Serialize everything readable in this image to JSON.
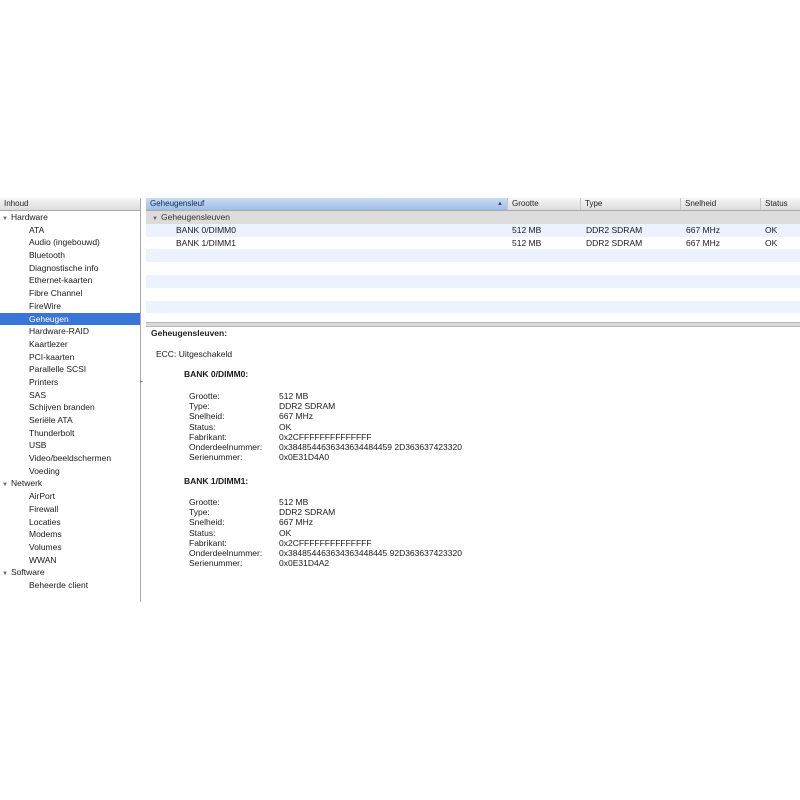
{
  "sidebar": {
    "header": "Inhoud",
    "items": [
      {
        "label": "Hardware",
        "type": "group"
      },
      {
        "label": "ATA",
        "type": "leaf"
      },
      {
        "label": "Audio (ingebouwd)",
        "type": "leaf"
      },
      {
        "label": "Bluetooth",
        "type": "leaf"
      },
      {
        "label": "Diagnostische info",
        "type": "leaf"
      },
      {
        "label": "Ethernet-kaarten",
        "type": "leaf"
      },
      {
        "label": "Fibre Channel",
        "type": "leaf"
      },
      {
        "label": "FireWire",
        "type": "leaf"
      },
      {
        "label": "Geheugen",
        "type": "leaf",
        "selected": true
      },
      {
        "label": "Hardware-RAID",
        "type": "leaf"
      },
      {
        "label": "Kaartlezer",
        "type": "leaf"
      },
      {
        "label": "PCI-kaarten",
        "type": "leaf"
      },
      {
        "label": "Parallelle SCSI",
        "type": "leaf"
      },
      {
        "label": "Printers",
        "type": "leaf"
      },
      {
        "label": "SAS",
        "type": "leaf"
      },
      {
        "label": "Schijven branden",
        "type": "leaf"
      },
      {
        "label": "Seriële ATA",
        "type": "leaf"
      },
      {
        "label": "Thunderbolt",
        "type": "leaf"
      },
      {
        "label": "USB",
        "type": "leaf"
      },
      {
        "label": "Video/beeldschermen",
        "type": "leaf"
      },
      {
        "label": "Voeding",
        "type": "leaf"
      },
      {
        "label": "Netwerk",
        "type": "group"
      },
      {
        "label": "AirPort",
        "type": "leaf"
      },
      {
        "label": "Firewall",
        "type": "leaf"
      },
      {
        "label": "Locaties",
        "type": "leaf"
      },
      {
        "label": "Modems",
        "type": "leaf"
      },
      {
        "label": "Volumes",
        "type": "leaf"
      },
      {
        "label": "WWAN",
        "type": "leaf"
      },
      {
        "label": "Software",
        "type": "group"
      },
      {
        "label": "Beheerde client",
        "type": "leaf"
      }
    ]
  },
  "table": {
    "columns": [
      "Geheugensleuf",
      "Grootte",
      "Type",
      "Snelheid",
      "Status"
    ],
    "group_label": "Geheugensleuven",
    "rows": [
      [
        "BANK 0/DIMM0",
        "512 MB",
        "DDR2 SDRAM",
        "667 MHz",
        "OK"
      ],
      [
        "BANK 1/DIMM1",
        "512 MB",
        "DDR2 SDRAM",
        "667 MHz",
        "OK"
      ]
    ]
  },
  "detail": {
    "title": "Geheugensleuven:",
    "ecc_label": "ECC:",
    "ecc_value": "Uitgeschakeld",
    "banks": [
      {
        "title": "BANK 0/DIMM0:",
        "fields": [
          {
            "k": "Grootte:",
            "v": "512 MB"
          },
          {
            "k": "Type:",
            "v": "DDR2 SDRAM"
          },
          {
            "k": "Snelheid:",
            "v": "667 MHz"
          },
          {
            "k": "Status:",
            "v": "OK"
          },
          {
            "k": "Fabrikant:",
            "v": "0x2CFFFFFFFFFFFFFF"
          },
          {
            "k": "Onderdeelnummer:",
            "v": "0x3848544636343634484459 2D363637423320"
          },
          {
            "k": "Serienummer:",
            "v": "0x0E31D4A0"
          }
        ]
      },
      {
        "title": "BANK 1/DIMM1:",
        "fields": [
          {
            "k": "Grootte:",
            "v": "512 MB"
          },
          {
            "k": "Type:",
            "v": "DDR2 SDRAM"
          },
          {
            "k": "Snelheid:",
            "v": "667 MHz"
          },
          {
            "k": "Status:",
            "v": "OK"
          },
          {
            "k": "Fabrikant:",
            "v": "0x2CFFFFFFFFFFFFFF"
          },
          {
            "k": "Onderdeelnummer:",
            "v": "0x384854463634363448445 92D363637423320"
          },
          {
            "k": "Serienummer:",
            "v": "0x0E31D4A2"
          }
        ]
      }
    ]
  },
  "colors": {
    "selection": "#3875d7",
    "stripe": "#edf3fe",
    "sorted_header": "#9fbde6"
  }
}
